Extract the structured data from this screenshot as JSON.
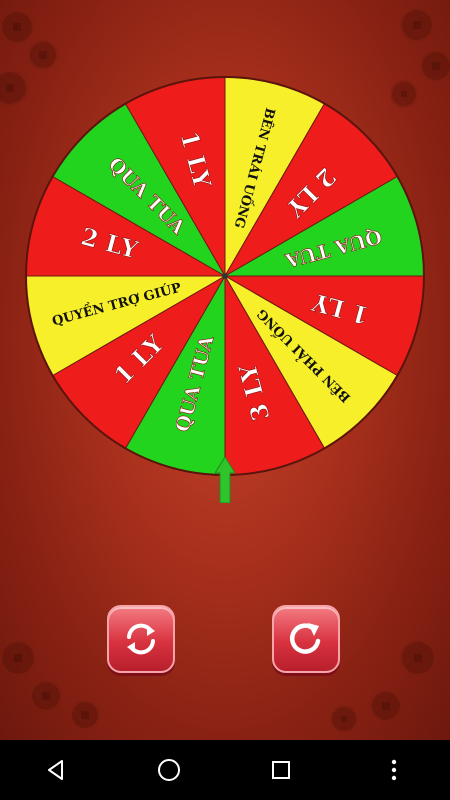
{
  "wheel": {
    "segments": [
      {
        "label": "BÊN TRÁI UỐNG",
        "color": "#f7ef2a"
      },
      {
        "label": "2 LY",
        "color": "#ef1c1c"
      },
      {
        "label": "QUA TUA",
        "color": "#22d41e"
      },
      {
        "label": "1 LY",
        "color": "#ef1c1c"
      },
      {
        "label": "BÊN PHẢI UỐNG",
        "color": "#f7ef2a"
      },
      {
        "label": "3 LY",
        "color": "#ef1c1c"
      },
      {
        "label": "QUA TUA",
        "color": "#22d41e"
      },
      {
        "label": "1 LY",
        "color": "#ef1c1c"
      },
      {
        "label": "QUYỀN TRỢ GIÚP",
        "color": "#f7ef2a"
      },
      {
        "label": "2 LY",
        "color": "#ef1c1c"
      },
      {
        "label": "QUA TUA",
        "color": "#22d41e"
      },
      {
        "label": "1 LY",
        "color": "#ef1c1c"
      }
    ]
  },
  "pointer": {
    "icon": "up-arrow-icon",
    "color": "#2fc42b"
  },
  "controls": {
    "left_icon": "refresh-icon",
    "right_icon": "rotate-right-icon"
  },
  "navbar": {
    "back_icon": "back-triangle-icon",
    "home_icon": "home-circle-icon",
    "recents_icon": "recents-square-icon",
    "menu_icon": "more-vert-icon"
  }
}
